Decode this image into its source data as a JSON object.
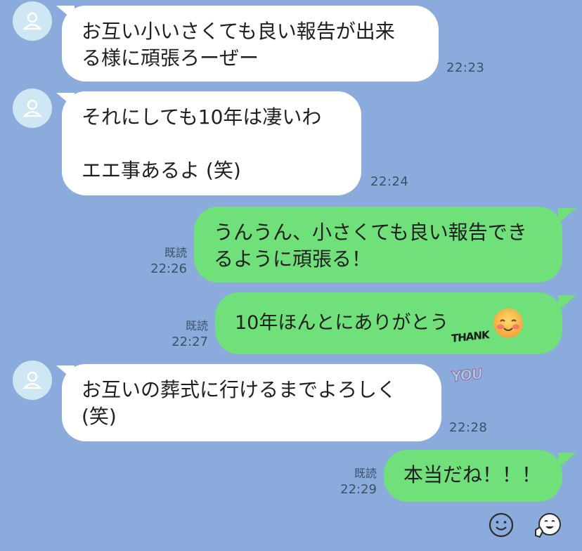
{
  "messages": [
    {
      "text": "お互い小いさくても良い報告が出来\nる様に頑張ろーぜー",
      "time": "22:23"
    },
    {
      "text": "それにしても10年は凄いわ\n\nエエ事あるよ (笑)",
      "time": "22:24"
    },
    {
      "text": "うんうん、小さくても良い報告でき\nるように頑張る！",
      "time": "22:26",
      "read": "既読"
    },
    {
      "text": "10年ほんとにありがとう",
      "time": "22:27",
      "read": "既読",
      "sticker": "THANK YOU",
      "sticker_top": "THANK",
      "sticker_bottom": "YOU"
    },
    {
      "text": "お互いの葬式に行けるまでよろしく\n(笑)",
      "time": "22:28"
    },
    {
      "text": "本当だね！！！",
      "time": "22:29",
      "read": "既読"
    }
  ],
  "icons": {
    "avatar": "person-icon",
    "emoji": "blushing-smile-emoji",
    "footer_left": "smiley-icon",
    "footer_right": "sticker-face-icon"
  },
  "colors": {
    "background": "#8aabdb",
    "incoming": "#ffffff",
    "outgoing": "#6fe07a"
  }
}
